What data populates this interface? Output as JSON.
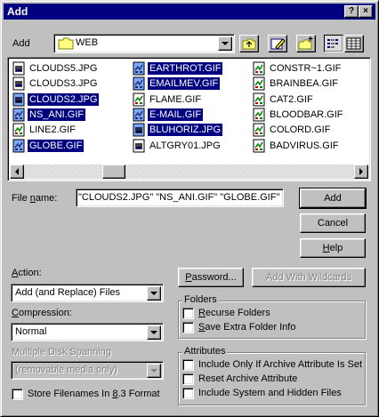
{
  "title": "Add",
  "title_buttons": {
    "help": "?",
    "close": "×"
  },
  "lookin": {
    "label": "Add",
    "folder": "WEB"
  },
  "files": [
    {
      "name": "CLOUDS5.JPG",
      "type": "jpg",
      "selected": false
    },
    {
      "name": "CLOUDS3.JPG",
      "type": "jpg",
      "selected": false
    },
    {
      "name": "CLOUDS2.JPG",
      "type": "jpg",
      "selected": true
    },
    {
      "name": "NS_ANI.GIF",
      "type": "gif",
      "selected": true
    },
    {
      "name": "LINE2.GIF",
      "type": "gif",
      "selected": false
    },
    {
      "name": "GLOBE.GIF",
      "type": "gif",
      "selected": true
    },
    {
      "name": "EARTHROT.GIF",
      "type": "gif",
      "selected": true
    },
    {
      "name": "EMAILMEV.GIF",
      "type": "gif",
      "selected": true
    },
    {
      "name": "FLAME.GIF",
      "type": "gif",
      "selected": false
    },
    {
      "name": "E-MAIL.GIF",
      "type": "gif",
      "selected": true
    },
    {
      "name": "BLUHORIZ.JPG",
      "type": "jpg",
      "selected": true
    },
    {
      "name": "ALTGRY01.JPG",
      "type": "jpg",
      "selected": false
    },
    {
      "name": "CONSTR~1.GIF",
      "type": "gif",
      "selected": false
    },
    {
      "name": "BRAINBEA.GIF",
      "type": "gif",
      "selected": false
    },
    {
      "name": "CAT2.GIF",
      "type": "gif",
      "selected": false
    },
    {
      "name": "BLOODBAR.GIF",
      "type": "gif",
      "selected": false
    },
    {
      "name": "COLORD.GIF",
      "type": "gif",
      "selected": false
    },
    {
      "name": "BADVIRUS.GIF",
      "type": "gif",
      "selected": false
    }
  ],
  "filename": {
    "label_pre": "File ",
    "label_u": "n",
    "label_post": "ame:",
    "value": "\"CLOUDS2.JPG\" \"NS_ANI.GIF\" \"GLOBE.GIF\""
  },
  "buttons": {
    "add": "Add",
    "cancel": "Cancel",
    "help_u": "H",
    "help_rest": "elp",
    "password_u": "P",
    "password_rest": "assword...",
    "add_wildcards": "Add With Wildcards"
  },
  "action": {
    "label_u": "A",
    "label_rest": "ction:",
    "value": "Add (and Replace) Files"
  },
  "compression": {
    "label_u": "C",
    "label_rest": "ompression:",
    "value": "Normal"
  },
  "spanning": {
    "label": "Multiple Disk Spanning",
    "value": "(removable media only)"
  },
  "store83": {
    "pre": "Store Filenames In ",
    "u": "8",
    "post": ".3 Format"
  },
  "folders": {
    "title": "Folders",
    "recurse_u": "R",
    "recurse_rest": "ecurse Folders",
    "extra_u": "S",
    "extra_rest": "ave Extra Folder Info"
  },
  "attributes": {
    "title": "Attributes",
    "archive_only": "Include Only If Archive Attribute Is Set",
    "reset_archive": "Reset Archive Attribute",
    "system_hidden": "Include System and Hidden Files"
  },
  "colors": {
    "title_bg": "#000080",
    "face": "#c0c0c0",
    "selection": "#000080"
  }
}
